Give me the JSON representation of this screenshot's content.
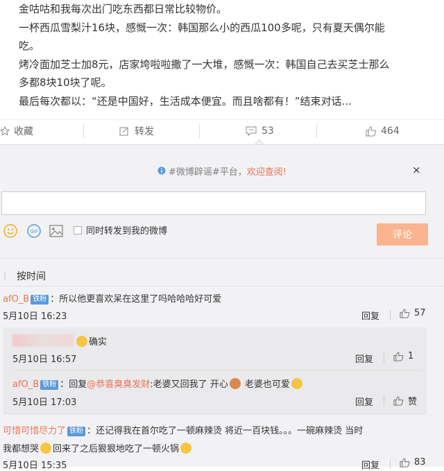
{
  "post": {
    "lines": [
      "金咕咕和我每次出门吃东西都日常比较物价。",
      "一杯西瓜雪梨汁16块，感慨一次：韩国那么小的西瓜100多呢，只有夏天偶尔能",
      "吃。",
      "烤冷面加芝士加8元，店家垮啦啦撒了一大堆，感慨一次：韩国自己去买芝士那么",
      "多都8块10块了呢。",
      "最后每次都以：“还是中国好，生活成本便宜。而且啥都有！”结束对话..."
    ]
  },
  "actions": {
    "favorite": "收藏",
    "repost": "转发",
    "comment_count": "53",
    "like_count": "464"
  },
  "notice": {
    "prefix": "#微博辟谣#平台，",
    "link": "欢迎查阅!",
    "close": "×"
  },
  "composer": {
    "placeholder": "",
    "also_repost_label": "同时转发到我的微博",
    "submit": "评论"
  },
  "sort": {
    "label": "按时间"
  },
  "comments": [
    {
      "user": "afO_B",
      "badge": "铁粉",
      "text": "：所以他更喜欢呆在这里了吗哈哈哈好可爱",
      "time": "5月10日 16:23",
      "reply": "回复",
      "likes": "57",
      "replies": [
        {
          "user": "",
          "text": "确实",
          "time": "5月10日 16:57",
          "reply": "回复",
          "likes": "1"
        },
        {
          "user": "afO_B",
          "badge": "铁粉",
          "pre": "：回复",
          "mention": "@恭喜臭臭发财",
          "text": ":老婆又回我了 开心",
          "text2": " 老婆也可爱",
          "time": "5月10日 17:03",
          "reply": "回复",
          "likes": "赞"
        }
      ]
    },
    {
      "user": "可惜可惜尽力了",
      "badge": "铁粉",
      "text": "：还记得我在首尔吃了一顿麻辣烫 将近一百块钱。。。一碗麻辣烫 当时",
      "text2": "我都想哭",
      "text3": "回来了之后狠狠地吃了一顿火锅",
      "time": "5月10日 15:35",
      "reply": "回复",
      "likes": "83"
    }
  ],
  "colors": {
    "accent": "#eb7350",
    "badge": "#5a9ad8",
    "submit": "#fbb48d",
    "panel": "#f2f2f5"
  }
}
